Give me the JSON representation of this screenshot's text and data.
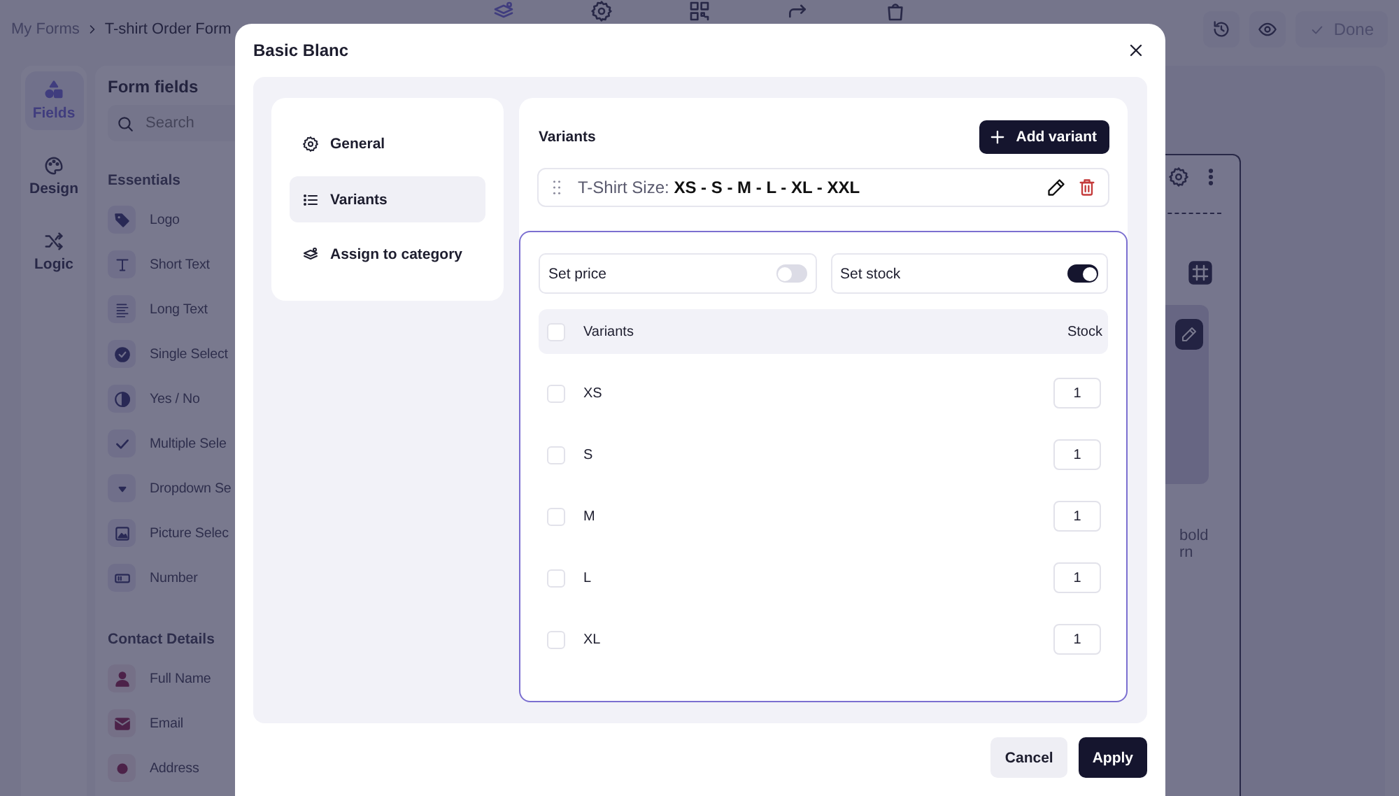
{
  "breadcrumb": [
    {
      "label": "My Forms"
    },
    {
      "label": "T-shirt Order Form"
    }
  ],
  "top_actions": {
    "done": "Done"
  },
  "rail": [
    {
      "label": "Fields",
      "selected": true
    },
    {
      "label": "Design",
      "selected": false
    },
    {
      "label": "Logic",
      "selected": false
    }
  ],
  "fields_panel": {
    "title": "Form fields",
    "search": {
      "placeholder": "Search"
    },
    "groups": [
      {
        "title": "Essentials",
        "items": [
          {
            "label": "Logo"
          },
          {
            "label": "Short Text"
          },
          {
            "label": "Long Text"
          },
          {
            "label": "Single Select"
          },
          {
            "label": "Yes / No"
          },
          {
            "label": "Multiple Sele"
          },
          {
            "label": "Dropdown Se"
          },
          {
            "label": "Picture Selec"
          },
          {
            "label": "Number"
          }
        ]
      },
      {
        "title": "Contact Details",
        "items": [
          {
            "label": "Full Name"
          },
          {
            "label": "Email"
          },
          {
            "label": "Address"
          }
        ]
      }
    ]
  },
  "canvas": {
    "texts": [
      "bold",
      "rn"
    ]
  },
  "modal": {
    "title": "Basic Blanc",
    "nav": [
      {
        "label": "General",
        "selected": false
      },
      {
        "label": "Variants",
        "selected": true
      },
      {
        "label": "Assign to category",
        "selected": false
      }
    ],
    "section_title": "Variants",
    "add_button": "Add variant",
    "variant_group": {
      "label": "T-Shirt Size: **XS - S - M - L - XL - XXL**"
    },
    "toggles": [
      {
        "label": "Set price",
        "on": false
      },
      {
        "label": "Set stock",
        "on": true
      }
    ],
    "table": {
      "columns": [
        "Variants",
        "Stock"
      ],
      "all_checked": false,
      "rows": [
        {
          "name": "XS",
          "checked": false,
          "stock": "1"
        },
        {
          "name": "S",
          "checked": false,
          "stock": "1"
        },
        {
          "name": "M",
          "checked": false,
          "stock": "1"
        },
        {
          "name": "L",
          "checked": false,
          "stock": "1"
        },
        {
          "name": "XL",
          "checked": false,
          "stock": "1"
        }
      ]
    },
    "buttons": {
      "cancel": "Cancel",
      "apply": "Apply"
    }
  }
}
